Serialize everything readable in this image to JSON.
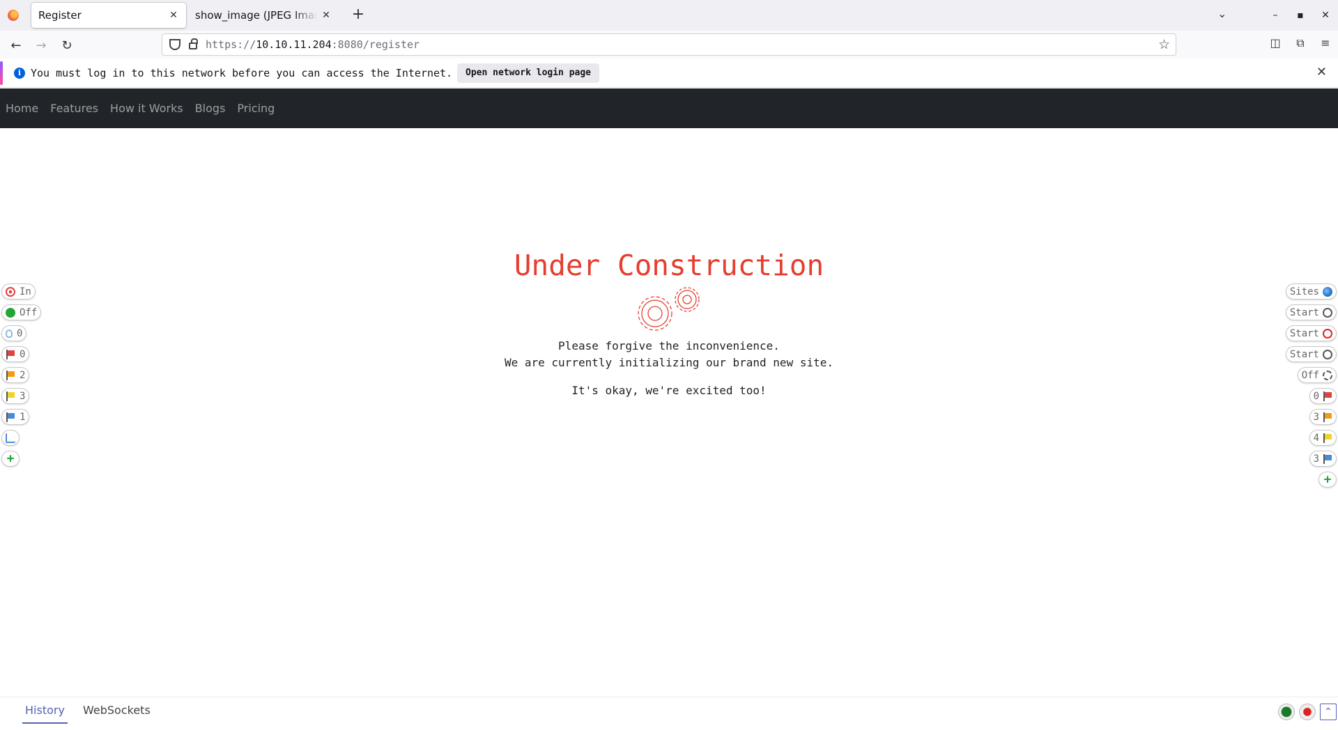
{
  "browser": {
    "tabs": [
      {
        "title": "Register",
        "active": true
      },
      {
        "title": "show_image (JPEG Image",
        "active": false
      }
    ],
    "url_prefix": "https://",
    "url_host": "10.10.11.204",
    "url_rest": ":8080/register"
  },
  "notification": {
    "message": "You must log in to this network before you can access the Internet.",
    "button": "Open network login page"
  },
  "site_nav": {
    "links": [
      "Home",
      "Features",
      "How it Works",
      "Blogs",
      "Pricing"
    ]
  },
  "content": {
    "heading": "Under Construction",
    "line1": "Please forgive the inconvenience.",
    "line2": "We are currently initializing our brand new site.",
    "line3": "It's okay, we're excited too!",
    "accent_color": "#e53e2f"
  },
  "hud": {
    "left": [
      {
        "label": "In",
        "icon": "target-icon"
      },
      {
        "label": "Off",
        "icon": "green-dot-icon"
      },
      {
        "label": "0",
        "icon": "bulb-icon"
      },
      {
        "label": "0",
        "icon": "red-flag-icon"
      },
      {
        "label": "2",
        "icon": "orange-flag-icon"
      },
      {
        "label": "3",
        "icon": "yellow-flag-icon"
      },
      {
        "label": "1",
        "icon": "blue-flag-icon"
      },
      {
        "label": "",
        "icon": "add-page-icon"
      },
      {
        "label": "",
        "icon": "plus-icon"
      }
    ],
    "right": [
      {
        "label": "Sites",
        "icon": "globe-icon"
      },
      {
        "label": "Start",
        "icon": "spider-icon"
      },
      {
        "label": "Start",
        "icon": "ajax-spider-icon"
      },
      {
        "label": "Start",
        "icon": "active-scan-icon"
      },
      {
        "label": "Off",
        "icon": "break-icon"
      },
      {
        "label": "0",
        "icon": "red-flag-icon"
      },
      {
        "label": "3",
        "icon": "orange-flag-icon"
      },
      {
        "label": "4",
        "icon": "yellow-flag-icon"
      },
      {
        "label": "3",
        "icon": "blue-flag-icon"
      },
      {
        "label": "",
        "icon": "plus-icon"
      }
    ],
    "bottom_tabs": [
      "History",
      "WebSockets"
    ]
  }
}
